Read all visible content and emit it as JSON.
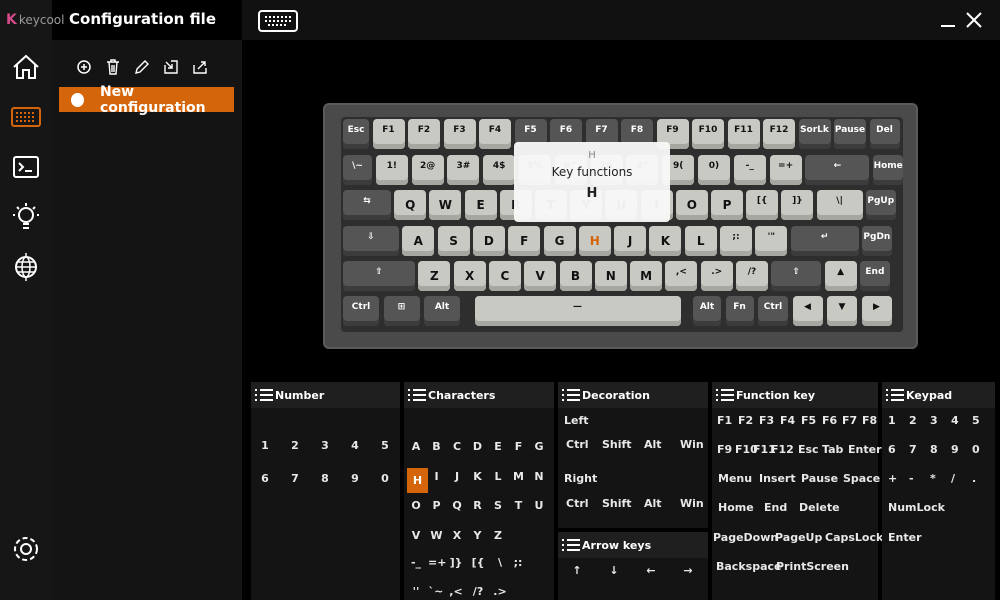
{
  "app": {
    "brand": "keycool",
    "title": "Configuration file"
  },
  "sidebar": {
    "config_name": "New configuration"
  },
  "keyboard": {
    "rows": [
      [
        "Esc",
        "F1",
        "F2",
        "F3",
        "F4",
        "F5",
        "F6",
        "F7",
        "F8",
        "F9",
        "F10",
        "F11",
        "F12",
        "SorLk",
        "Pause",
        "Del"
      ],
      [
        "\\~",
        "1!",
        "2@",
        "3#",
        "4$",
        "5%",
        "6^",
        "7&",
        "8*",
        "9(",
        "0)",
        "-_",
        "=+",
        "←",
        "Home"
      ],
      [
        "⇆",
        "Q",
        "W",
        "E",
        "R",
        "T",
        "Y",
        "U",
        "I",
        "O",
        "P",
        "[{",
        "]}",
        "\\|",
        "PgUp"
      ],
      [
        "⇩",
        "A",
        "S",
        "D",
        "F",
        "G",
        "H",
        "J",
        "K",
        "L",
        ";:",
        "'\"",
        "↵",
        "PgDn"
      ],
      [
        "⇧",
        "Z",
        "X",
        "C",
        "V",
        "B",
        "N",
        "M",
        ",<",
        ".>",
        "/?",
        "⇧",
        "▲",
        "End"
      ],
      [
        "Ctrl",
        "⊞",
        "Alt",
        "—",
        "Alt",
        "Fn",
        "Ctrl",
        "◀",
        "▼",
        "▶"
      ]
    ]
  },
  "tooltip": {
    "key": "H",
    "title": "Key functions",
    "value": "H"
  },
  "panels": {
    "number": {
      "title": "Number",
      "items": [
        "1",
        "2",
        "3",
        "4",
        "5",
        "6",
        "7",
        "8",
        "9",
        "0"
      ]
    },
    "characters": {
      "title": "Characters",
      "items": [
        "A",
        "B",
        "C",
        "D",
        "E",
        "F",
        "G",
        "H",
        "I",
        "J",
        "K",
        "L",
        "M",
        "N",
        "O",
        "P",
        "Q",
        "R",
        "S",
        "T",
        "U",
        "V",
        "W",
        "X",
        "Y",
        "Z",
        "-_",
        "=+",
        "]}",
        "[{",
        "\\",
        ";:",
        "''",
        "`~",
        ",<",
        "/?",
        ".>"
      ],
      "selected": "H"
    },
    "decoration": {
      "title": "Decoration",
      "left_label": "Left",
      "right_label": "Right",
      "items": [
        "Ctrl",
        "Shift",
        "Alt",
        "Win"
      ]
    },
    "arrow": {
      "title": "Arrow keys",
      "items": [
        "↑",
        "↓",
        "←",
        "→"
      ]
    },
    "function": {
      "title": "Function key",
      "rows": [
        [
          "F1",
          "F2",
          "F3",
          "F4",
          "F5",
          "F6",
          "F7",
          "F8"
        ],
        [
          "F9",
          "F10",
          "F11",
          "F12",
          "Esc",
          "Tab",
          "Enter"
        ],
        [
          "Menu",
          "Insert",
          "Pause",
          "Space"
        ],
        [
          "Home",
          "End",
          "Delete"
        ],
        [
          "PageDown",
          "PageUp",
          "CapsLock"
        ],
        [
          "Backspace",
          "PrintScreen"
        ]
      ]
    },
    "keypad": {
      "title": "Keypad",
      "rows": [
        [
          "1",
          "2",
          "3",
          "4",
          "5"
        ],
        [
          "6",
          "7",
          "8",
          "9",
          "0"
        ],
        [
          "+",
          "-",
          "*",
          "/",
          "."
        ],
        [
          "NumLock"
        ],
        [
          "Enter"
        ]
      ]
    }
  }
}
